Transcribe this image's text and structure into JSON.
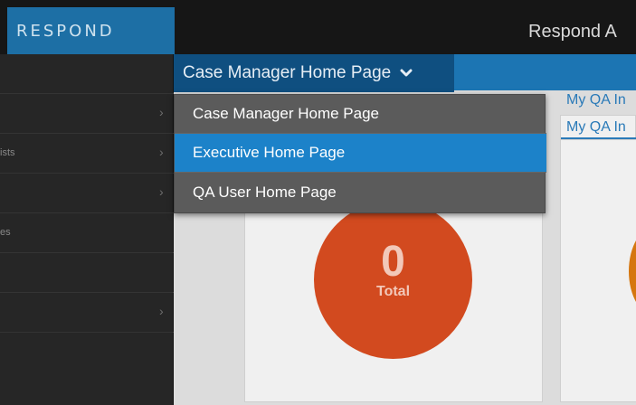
{
  "header": {
    "logo_text": "RESPOND",
    "app_title": "Respond A",
    "colors": {
      "brand_blue": "#1d6fa5",
      "topbar_bg": "#161616"
    }
  },
  "sidebar": {
    "items": [
      {
        "label": "",
        "chevron": ""
      },
      {
        "label": "",
        "chevron": "›"
      },
      {
        "label": "ists",
        "chevron": "›"
      },
      {
        "label": "",
        "chevron": "›"
      },
      {
        "label": "es",
        "chevron": ""
      },
      {
        "label": "",
        "chevron": ""
      },
      {
        "label": "",
        "chevron": "›"
      }
    ]
  },
  "page_selector": {
    "current": "Case Manager Home Page",
    "icon": "chevron-down-icon",
    "options": [
      {
        "label": "Case Manager Home Page",
        "active": false
      },
      {
        "label": "Executive Home Page",
        "active": true
      },
      {
        "label": "QA User Home Page",
        "active": false
      }
    ]
  },
  "widgets": {
    "qa_card_title": "My QA In",
    "total_count": "0",
    "total_label": "Total"
  }
}
